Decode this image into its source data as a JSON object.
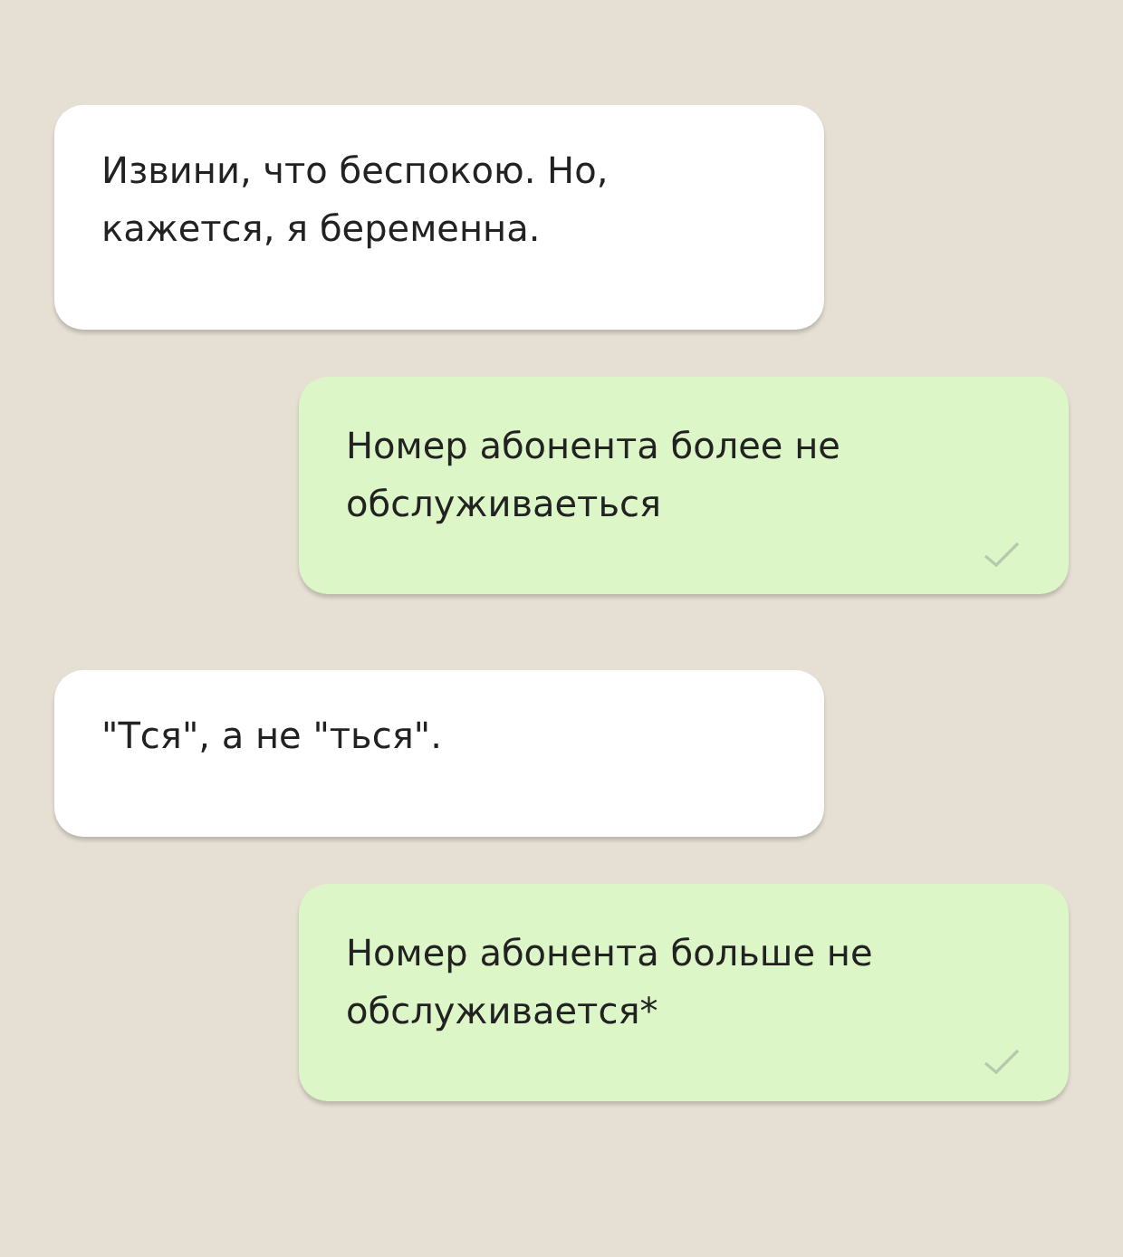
{
  "messages": [
    {
      "kind": "incoming",
      "text": "Извини, что беспокою. Но, кажется, я беременна."
    },
    {
      "kind": "outgoing",
      "text": "Номер абонента более не обслуживаеться",
      "sent": true
    },
    {
      "kind": "incoming",
      "text": "\"Тся\", а не \"ться\"."
    },
    {
      "kind": "outgoing",
      "text": "Номер абонента больше не обслуживается*",
      "sent": true
    }
  ]
}
